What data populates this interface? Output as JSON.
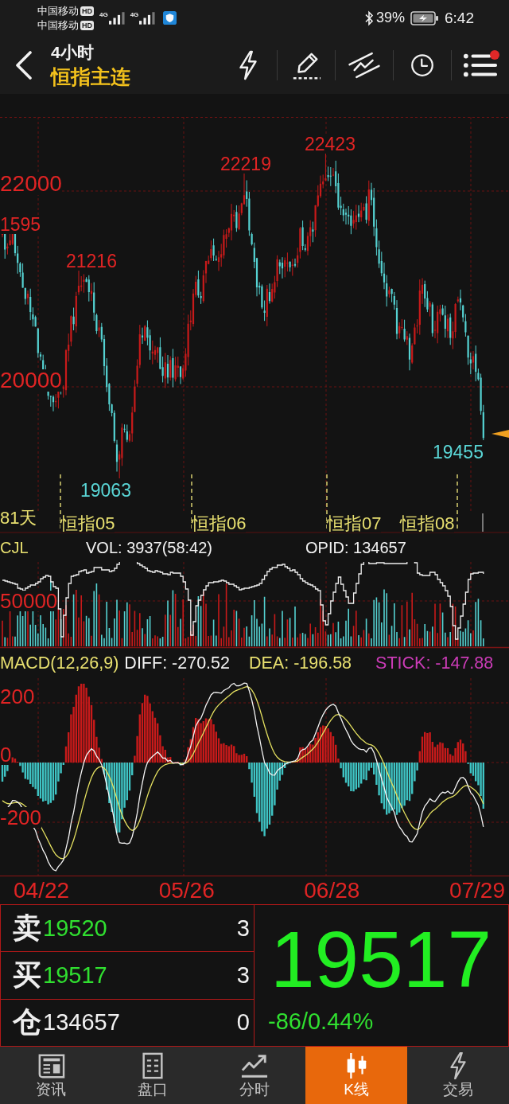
{
  "status_bar": {
    "carriers": [
      {
        "name": "中国移动",
        "badge": "HD"
      },
      {
        "name": "中国移动",
        "badge": "HD"
      }
    ],
    "signals": [
      {
        "network": "4G"
      },
      {
        "network": "4G"
      }
    ],
    "battery": "39%",
    "time": "6:42"
  },
  "header": {
    "period": "4小时",
    "instrument": "恒指主连",
    "toolbar": [
      {
        "kind": "flash",
        "notification": false
      },
      {
        "kind": "draw",
        "notification": false
      },
      {
        "kind": "lines",
        "notification": false
      },
      {
        "kind": "clock",
        "notification": false
      },
      {
        "kind": "menu",
        "notification": true
      }
    ]
  },
  "price_chart": {
    "axis_labels": [
      "22000",
      "20000"
    ],
    "high_labels": [
      "1595",
      "21216",
      "22219",
      "22423"
    ],
    "low_labels": [
      "19063",
      "19455"
    ],
    "period_count": "81天",
    "contracts": [
      "恒指05",
      "恒指06",
      "恒指07",
      "恒指08"
    ]
  },
  "volume_panel": {
    "name": "CJL",
    "vol": "VOL: 3937(58:42)",
    "open_interest": "OPID: 134657",
    "axis_label": "50000"
  },
  "macd_panel": {
    "title": "MACD(12,26,9)",
    "diff": "DIFF: -270.52",
    "dea": "DEA: -196.58",
    "stick": "STICK: -147.88",
    "axis_labels": [
      "200",
      "0",
      "-200"
    ]
  },
  "date_axis": [
    "04/22",
    "05/26",
    "06/28",
    "07/29"
  ],
  "quote": {
    "rows": [
      {
        "kind": "ask",
        "label": "卖",
        "price": "19520",
        "qty": "3"
      },
      {
        "kind": "bid",
        "label": "买",
        "price": "19517",
        "qty": "3"
      },
      {
        "kind": "open_interest",
        "label": "仓",
        "price": "134657",
        "qty": "0"
      }
    ],
    "last": "19517",
    "change": "-86/0.44%"
  },
  "tabs": [
    {
      "label": "资讯",
      "selected": false
    },
    {
      "label": "盘口",
      "selected": false
    },
    {
      "label": "分时",
      "selected": false
    },
    {
      "label": "K线",
      "selected": true
    },
    {
      "label": "交易",
      "selected": false
    }
  ]
}
